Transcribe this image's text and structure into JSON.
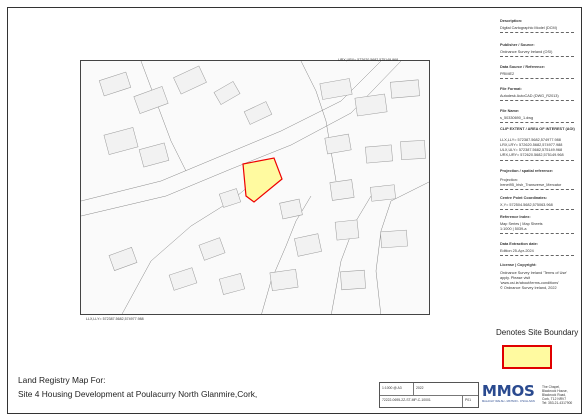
{
  "map": {
    "ur_coord_label": "URX,URY= 572620.5682,575149.968",
    "ll_coord_label": "LLX,LLY= 572387.5682,574977.988"
  },
  "sidebar": {
    "description_head": "Description:",
    "description_value": "Digital Cartographic Model (DCM)",
    "publisher_head": "Publisher / Source:",
    "publisher_value": "Ordnance Survey Ireland (OSI)",
    "datasource_head": "Data Source / Reference:",
    "datasource_value": "PRIME2",
    "fileformat_head": "File Format:",
    "fileformat_value": "Autodesk AutoCAD (DWG_R2013)",
    "filename_head": "File Name:",
    "filename_value": "s_50330690_1.dwg",
    "clip_head": "CLIP EXTENT / AREA OF INTEREST (AOI)",
    "clip_lines": [
      "LLX,LLY= 572387.5682,574977.988",
      "LRX,LRY= 572620.5682,574977.988",
      "ULX,ULY= 572387.5682,575149.968",
      "URX,URY= 572620.5682,575149.968"
    ],
    "projection_head": "Projection / spatial reference:",
    "projection_label": "Projection:",
    "projection_value": "Irenet95_Irish_Transverse_Mercator",
    "centre_head": "Centre Point Coordinates:",
    "centre_value": "X,Y= 572504.5682,575063.968",
    "reference_head": "Reference Index:",
    "reference_value": "Map Series | Map Sheets",
    "reference_sheet": "1:1000 | 5039-a",
    "extraction_head": "Data Extraction date:",
    "extraction_value": "Edition 25-Apr-2024",
    "license_head": "License | Copyright:",
    "license_lines": [
      "Ordnance Survey Ireland 'Terms of Use'",
      "apply. Please visit",
      "'www.osi.ie/about/terms-conditions'",
      "© Ordnance Survey Ireland, 2022"
    ]
  },
  "legend": {
    "title": "Denotes Site Boundary",
    "fill_color": "#fffaa0",
    "border_color": "#e00000"
  },
  "title_block": {
    "line1": "Land Registry Map For:",
    "line2": "Site 4 Housing Development at Poulacurry North Glanmire,Cork,"
  },
  "info_cells": {
    "scale": "1:1000 @ A3",
    "date": "2022",
    "drawing_no": "72222-0695-2Z-ST-MP-C-10001",
    "rev": "P01"
  },
  "company": {
    "logo": "MMOS",
    "subtitle": "MALACHY WALSH - MATSON - O'SULLIVAN",
    "address_lines": [
      "The Chapel,",
      "Blackrock House,",
      "Blackrock Road,",
      "Cork, T12 NRV7",
      "Tel: 353-21-4317900"
    ]
  }
}
